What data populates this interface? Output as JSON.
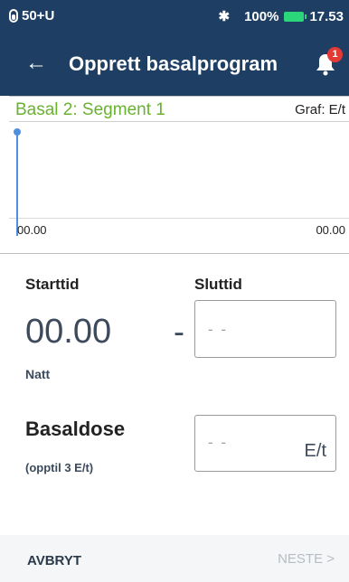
{
  "statusbar": {
    "pod_text": "50+U",
    "battery_text": "100%",
    "time": "17.53",
    "icons": [
      "pod-icon",
      "bluetooth-icon",
      "battery-icon"
    ]
  },
  "appbar": {
    "title": "Opprett basalprogram",
    "notification_count": "1"
  },
  "graph": {
    "segment_label": "Basal 2: Segment 1",
    "unit_label": "Graf: E/t",
    "start_tick": "00.00",
    "end_tick": "00.00"
  },
  "form": {
    "start_label": "Starttid",
    "end_label": "Sluttid",
    "start_value": "00.00",
    "separator": "-",
    "start_period": "Natt",
    "end_placeholder": "- -",
    "dose_label": "Basaldose",
    "dose_hint": "(opptil 3 E/t)",
    "dose_placeholder": "- -",
    "dose_unit": "E/t"
  },
  "footer": {
    "cancel_label": "AVBRYT",
    "next_label": "NESTE >"
  },
  "colors": {
    "header": "#1e3f63",
    "segment_green": "#69b230",
    "graph_blue": "#4f8fe0",
    "badge_red": "#e53935"
  }
}
